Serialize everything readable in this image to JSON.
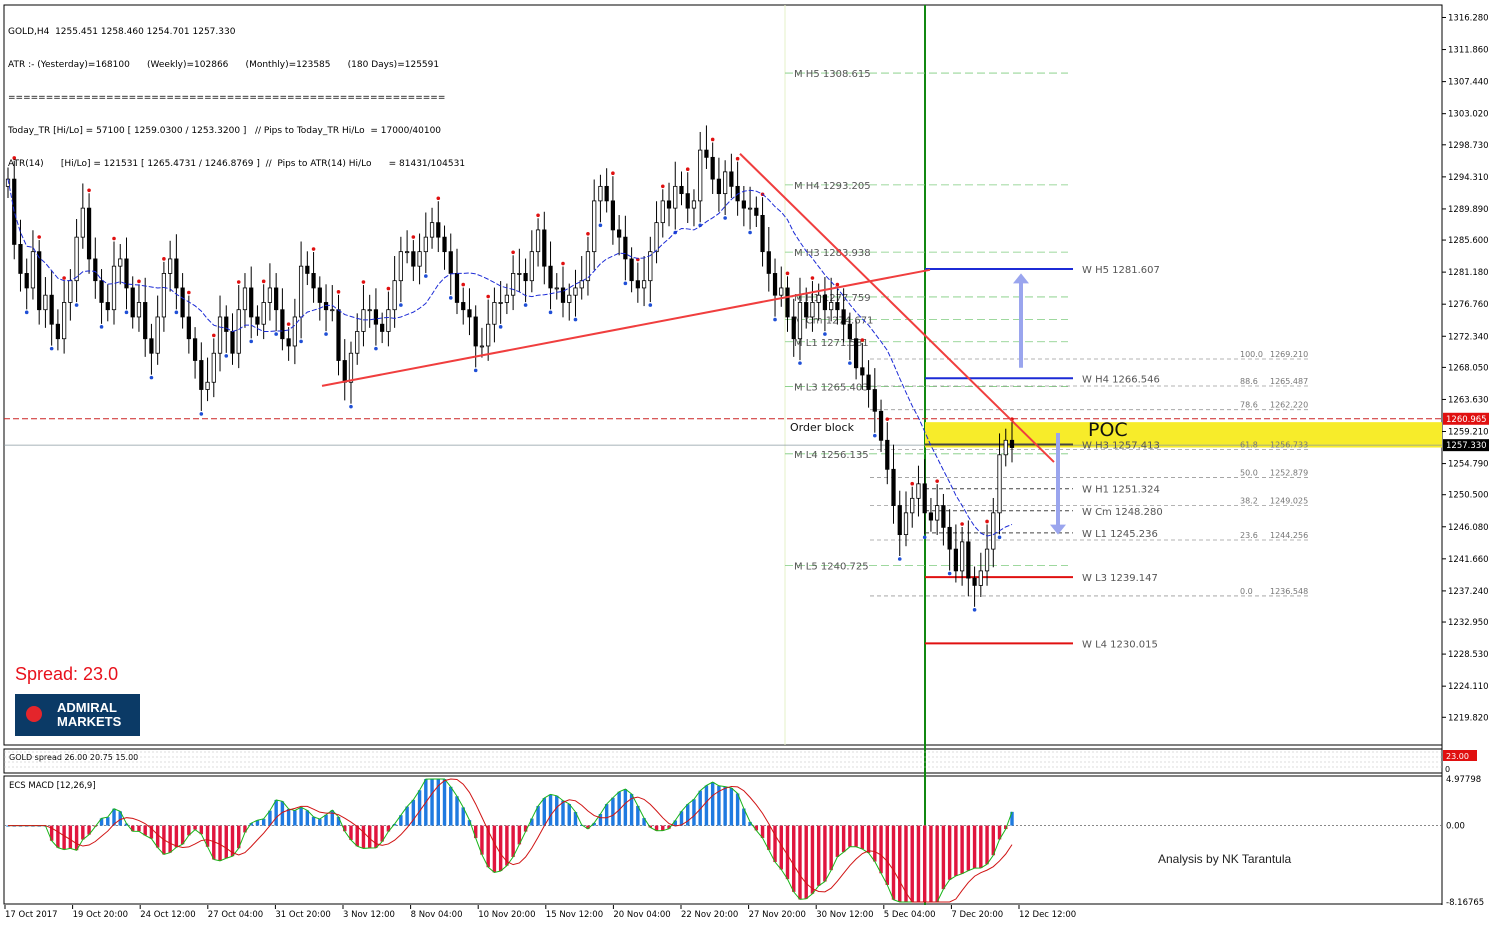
{
  "header": {
    "line1": "GOLD,H4  1255.451 1258.460 1254.701 1257.330",
    "line2": "ATR :- (Yesterday)=168100      (Weekly)=102866      (Monthly)=123585      (180 Days)=125591",
    "line3": "==========================================================",
    "line4": "Today_TR [Hi/Lo] = 57100 [ 1259.0300 / 1253.3200 ]   // Pips to Today_TR Hi/Lo  = 17000/40100",
    "line5": "ATR(14)      [Hi/Lo] = 121531 [ 1265.4731 / 1246.8769 ]  //  Pips to ATR(14) Hi/Lo      = 81431/104531"
  },
  "spread_label": "Spread:  23.0",
  "logo": {
    "line1": "ADMIRAL",
    "line2": "MARKETS"
  },
  "credit": "Analysis by NK Tarantula",
  "order_block_label": "Order block",
  "poc_label": "POC",
  "colors": {
    "bull": "#1f7ae0",
    "bear": "#e0153e",
    "trend": "#f03e3e",
    "ma": "#1c2bd6",
    "poc": "#f7ec2a",
    "weekly_pivot": "#1c2bd6",
    "weekly_low": "#e01010",
    "monthly_pivot": "#7ecb7e",
    "vline": "#118811",
    "fib": "#9a9a9a"
  },
  "chart_data": [
    {
      "type": "candlestick",
      "symbol": "GOLD",
      "timeframe": "H4",
      "ylim": [
        1216.0,
        1318.0
      ],
      "y_ticks": [
        "1316.280",
        "1311.860",
        "1307.440",
        "1303.020",
        "1298.730",
        "1294.310",
        "1289.890",
        "1285.600",
        "1281.180",
        "1276.760",
        "1272.340",
        "1268.050",
        "1263.630",
        "1259.210",
        "1254.790",
        "1250.500",
        "1246.080",
        "1241.660",
        "1237.240",
        "1232.950",
        "1228.530",
        "1224.110",
        "1219.820"
      ],
      "x_ticks": [
        "17 Oct 2017",
        "19 Oct 20:00",
        "24 Oct 12:00",
        "27 Oct 04:00",
        "31 Oct 20:00",
        "3 Nov 12:00",
        "8 Nov 04:00",
        "10 Nov 20:00",
        "15 Nov 12:00",
        "20 Nov 04:00",
        "22 Nov 20:00",
        "27 Nov 20:00",
        "30 Nov 12:00",
        "5 Dec 04:00",
        "7 Dec 20:00",
        "12 Dec 12:00"
      ],
      "current_price": "1257.330",
      "ask_line": "1260.965",
      "closes": [
        1294,
        1285,
        1281,
        1279,
        1284,
        1276,
        1278,
        1274,
        1272,
        1277,
        1280,
        1286,
        1290,
        1283,
        1280,
        1277,
        1276,
        1282,
        1283,
        1279,
        1275,
        1277,
        1272,
        1270,
        1275,
        1281,
        1283,
        1279,
        1275,
        1272,
        1269,
        1265,
        1266,
        1270,
        1275,
        1273,
        1270,
        1276,
        1279,
        1275,
        1274,
        1277,
        1279,
        1276,
        1272,
        1271,
        1275,
        1282,
        1281,
        1279,
        1277,
        1276,
        1276,
        1269,
        1266,
        1270,
        1273,
        1276,
        1276,
        1274,
        1273,
        1276,
        1280,
        1284,
        1284,
        1282,
        1284,
        1286,
        1288,
        1286,
        1284,
        1281,
        1277,
        1276,
        1275,
        1271,
        1271,
        1274,
        1277,
        1277,
        1278,
        1281,
        1281,
        1280,
        1284,
        1287,
        1282,
        1279,
        1279,
        1277,
        1278,
        1279,
        1280,
        1284,
        1291,
        1293,
        1291,
        1287,
        1286,
        1283,
        1280,
        1279,
        1280,
        1284,
        1288,
        1291,
        1290,
        1293,
        1292,
        1290,
        1291,
        1298,
        1297,
        1294,
        1292,
        1295,
        1293,
        1291,
        1290,
        1290,
        1289,
        1284,
        1281,
        1278,
        1279,
        1275,
        1272,
        1277,
        1275,
        1277,
        1278,
        1276,
        1277,
        1276,
        1274,
        1272,
        1268,
        1267,
        1265,
        1262,
        1258,
        1254,
        1249,
        1245,
        1248,
        1250,
        1252,
        1248,
        1247,
        1249,
        1246,
        1243,
        1240,
        1244,
        1239,
        1238,
        1240,
        1243,
        1248,
        1256,
        1258,
        1257
      ],
      "ma_period_note": "",
      "trendlines": [
        {
          "from": [
            "Nov 3",
            1265.5
          ],
          "to": [
            "Dec 8",
            1281.5
          ]
        },
        {
          "from": [
            "Nov 27",
            1297.5
          ],
          "to": [
            "Dec 13",
            1255.0
          ]
        }
      ],
      "poc_zone": [
        1257.0,
        1260.5
      ],
      "monthly_pivots": [
        {
          "label": "M  H5 1308.615",
          "value": 1308.615
        },
        {
          "label": "M  H4 1293.205",
          "value": 1293.205
        },
        {
          "label": "M  H3 1283.938",
          "value": 1283.938
        },
        {
          "label": "M  H1 1277.759",
          "value": 1277.759
        },
        {
          "label": "M  Cm 1274.671",
          "value": 1274.671
        },
        {
          "label": "M  L1 1271.581",
          "value": 1271.581
        },
        {
          "label": "M  L3 1265.403",
          "value": 1265.403
        },
        {
          "label": "M  L4 1256.135",
          "value": 1256.135
        },
        {
          "label": "M  L5 1240.725",
          "value": 1240.725
        }
      ],
      "weekly_pivots": [
        {
          "label": "W  H5 1281.607",
          "value": 1281.607
        },
        {
          "label": "W  H4 1266.546",
          "value": 1266.546
        },
        {
          "label": "W  H3 1257.413",
          "value": 1257.413
        },
        {
          "label": "W  H1 1251.324",
          "value": 1251.324
        },
        {
          "label": "W  Cm  1248.280",
          "value": 1248.28
        },
        {
          "label": "W  L1 1245.236",
          "value": 1245.236
        },
        {
          "label": "W  L3 1239.147",
          "value": 1239.147
        },
        {
          "label": "W  L4 1230.015",
          "value": 1230.015
        }
      ],
      "fibonacci": [
        {
          "level": "100.0",
          "price": "1269.210"
        },
        {
          "level": "88.6",
          "price": "1265.487"
        },
        {
          "level": "78.6",
          "price": "1262.220"
        },
        {
          "level": "61.8",
          "price": "1256.733"
        },
        {
          "level": "50.0",
          "price": "1252.879"
        },
        {
          "level": "38.2",
          "price": "1249.025"
        },
        {
          "level": "23.6",
          "price": "1244.256"
        },
        {
          "level": "0.0",
          "price": "1236.548"
        }
      ]
    },
    {
      "type": "indicator",
      "title": "GOLD spread 26.00 20.75 15.00",
      "value_label": "23.00",
      "axis_label": "0"
    },
    {
      "type": "macd",
      "title": "ECS MACD [12,26,9]",
      "y_ticks": [
        "4.97798",
        "0.00",
        "-8.16765"
      ],
      "ylim": [
        -8.16765,
        4.97798
      ]
    }
  ]
}
